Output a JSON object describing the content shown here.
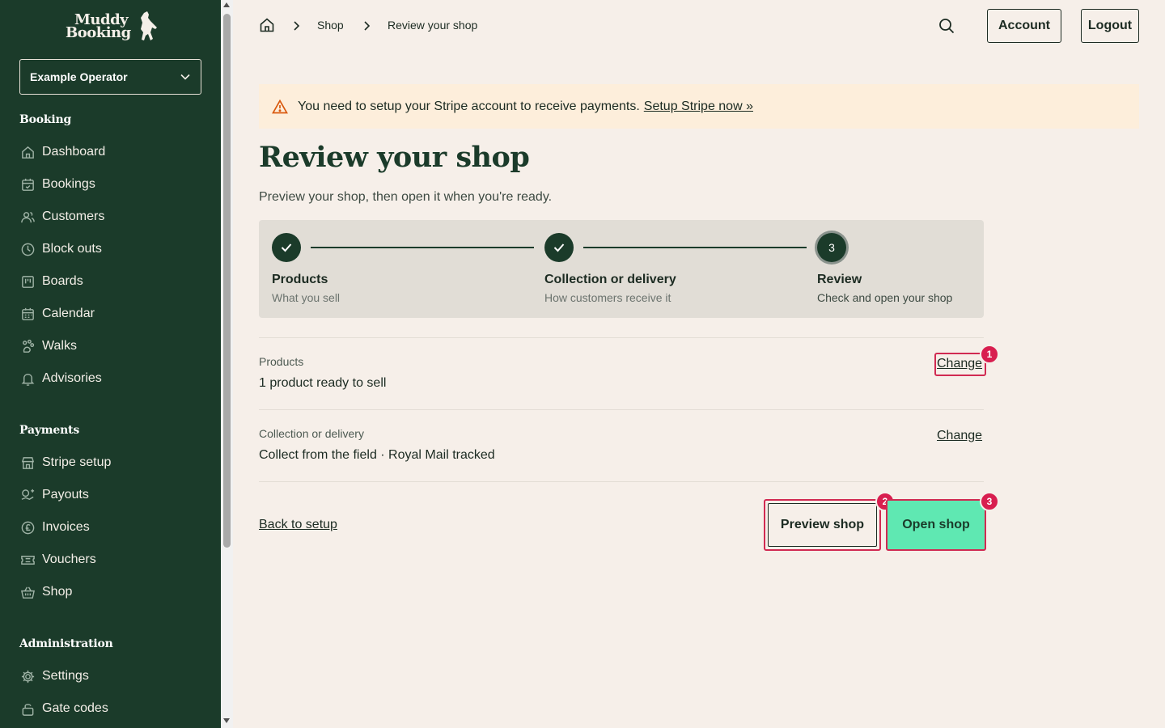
{
  "brand": {
    "line1": "Muddy",
    "line2": "Booking"
  },
  "operator": {
    "selected": "Example Operator"
  },
  "sidebar": {
    "sections": [
      {
        "heading": "Booking",
        "items": [
          {
            "label": "Dashboard",
            "icon": "home-icon"
          },
          {
            "label": "Bookings",
            "icon": "calendar-check-icon"
          },
          {
            "label": "Customers",
            "icon": "users-icon"
          },
          {
            "label": "Block outs",
            "icon": "clock-icon"
          },
          {
            "label": "Boards",
            "icon": "board-icon"
          },
          {
            "label": "Calendar",
            "icon": "calendar-icon"
          },
          {
            "label": "Walks",
            "icon": "paw-icon"
          },
          {
            "label": "Advisories",
            "icon": "bell-icon"
          }
        ]
      },
      {
        "heading": "Payments",
        "items": [
          {
            "label": "Stripe setup",
            "icon": "store-icon"
          },
          {
            "label": "Payouts",
            "icon": "payout-icon"
          },
          {
            "label": "Invoices",
            "icon": "pound-icon"
          },
          {
            "label": "Vouchers",
            "icon": "ticket-icon"
          },
          {
            "label": "Shop",
            "icon": "basket-icon"
          }
        ]
      },
      {
        "heading": "Administration",
        "items": [
          {
            "label": "Settings",
            "icon": "gear-icon"
          },
          {
            "label": "Gate codes",
            "icon": "lock-icon"
          }
        ]
      }
    ]
  },
  "breadcrumb": {
    "items": [
      "Shop",
      "Review your shop"
    ]
  },
  "header": {
    "account_label": "Account",
    "logout_label": "Logout"
  },
  "alert": {
    "text": "You need to setup your Stripe account to receive payments.",
    "link": "Setup Stripe now »"
  },
  "page": {
    "title": "Review your shop",
    "subtitle": "Preview your shop, then open it when you're ready."
  },
  "steps": [
    {
      "title": "Products",
      "desc": "What you sell",
      "state": "done"
    },
    {
      "title": "Collection or delivery",
      "desc": "How customers receive it",
      "state": "done"
    },
    {
      "number": "3",
      "title": "Review",
      "desc": "Check and open your shop",
      "state": "current"
    }
  ],
  "summary": [
    {
      "label": "Products",
      "value": "1 product ready to sell",
      "action": "Change"
    },
    {
      "label": "Collection or delivery",
      "value": "Collect from the field · Royal Mail tracked",
      "action": "Change"
    }
  ],
  "actions": {
    "back_label": "Back to setup",
    "preview_label": "Preview shop",
    "open_label": "Open shop"
  },
  "markers": [
    "1",
    "2",
    "3"
  ],
  "colors": {
    "sidebar_bg": "#1b3b2a",
    "page_bg": "#f6efe9",
    "alert_bg": "#fdeedb",
    "primary_btn": "#5fe8b2",
    "highlight": "#d12a52"
  }
}
